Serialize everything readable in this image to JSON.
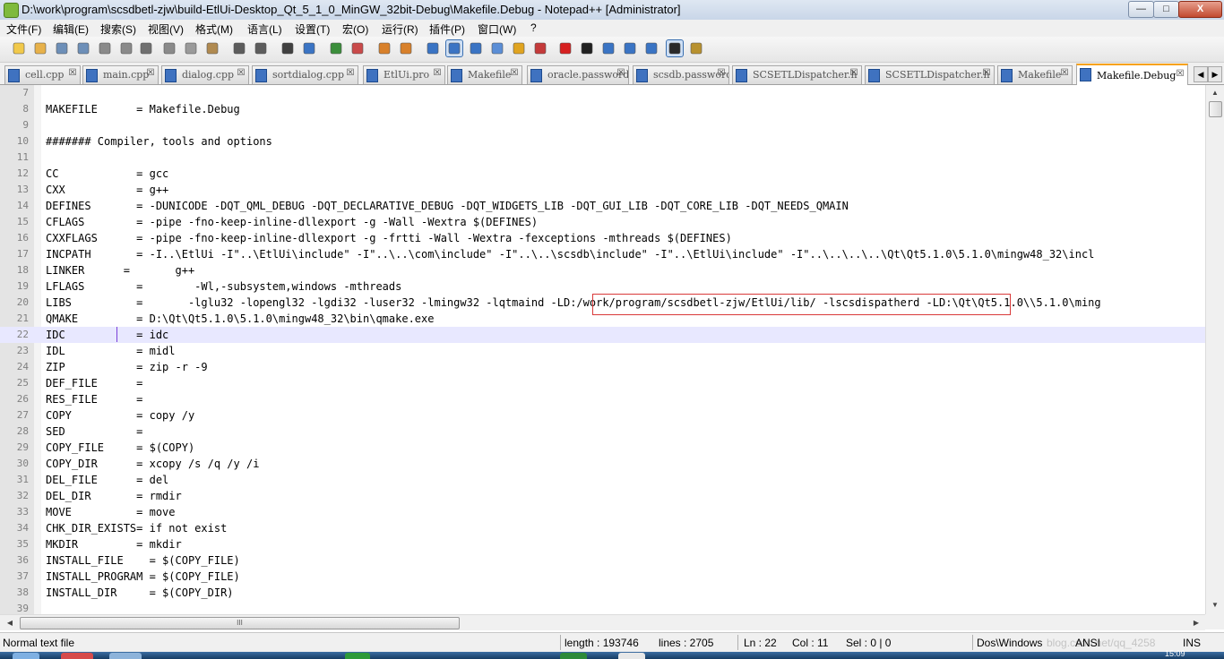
{
  "window": {
    "title": "D:\\work\\program\\scsdbetl-zjw\\build-EtlUi-Desktop_Qt_5_1_0_MinGW_32bit-Debug\\Makefile.Debug - Notepad++ [Administrator]",
    "minimize": "—",
    "maximize": "□",
    "close": "X"
  },
  "menu": [
    {
      "id": "file",
      "label": "文件(F)"
    },
    {
      "id": "edit",
      "label": "编辑(E)"
    },
    {
      "id": "search",
      "label": "搜索(S)"
    },
    {
      "id": "view",
      "label": "视图(V)"
    },
    {
      "id": "format",
      "label": "格式(M)"
    },
    {
      "id": "language",
      "label": "语言(L)"
    },
    {
      "id": "settings",
      "label": "设置(T)"
    },
    {
      "id": "macro",
      "label": "宏(O)"
    },
    {
      "id": "run",
      "label": "运行(R)"
    },
    {
      "id": "plugins",
      "label": "插件(P)"
    },
    {
      "id": "window",
      "label": "窗口(W)"
    },
    {
      "id": "help",
      "label": "?"
    }
  ],
  "toolbar": [
    {
      "name": "new-file-icon",
      "color": "#f1c94b"
    },
    {
      "name": "open-file-icon",
      "color": "#e7b14a"
    },
    {
      "name": "save-icon",
      "color": "#6d8fb8"
    },
    {
      "name": "save-all-icon",
      "color": "#6d8fb8"
    },
    {
      "name": "close-file-icon",
      "color": "#8a8a8a"
    },
    {
      "name": "close-all-icon",
      "color": "#8a8a8a"
    },
    {
      "name": "print-icon",
      "color": "#707070"
    },
    {
      "name": "cut-icon",
      "color": "#8a8a8a"
    },
    {
      "name": "copy-icon",
      "color": "#9a9a9a"
    },
    {
      "name": "paste-icon",
      "color": "#b08a50"
    },
    {
      "name": "undo-icon",
      "color": "#5c5c5c"
    },
    {
      "name": "redo-icon",
      "color": "#5c5c5c"
    },
    {
      "name": "find-icon",
      "color": "#404040"
    },
    {
      "name": "replace-icon",
      "color": "#3a74c4"
    },
    {
      "name": "zoom-in-icon",
      "color": "#3b8e3b"
    },
    {
      "name": "zoom-out-icon",
      "color": "#c94a4a"
    },
    {
      "name": "sync-vertical-icon",
      "color": "#d8802a"
    },
    {
      "name": "sync-horizontal-icon",
      "color": "#d8802a"
    },
    {
      "name": "word-wrap-icon",
      "color": "#3a74c4"
    },
    {
      "name": "show-all-chars-icon",
      "color": "#3a74c4"
    },
    {
      "name": "indent-guide-icon",
      "color": "#3a74c4"
    },
    {
      "name": "user-language-icon",
      "color": "#5b8ed6"
    },
    {
      "name": "doc-map-icon",
      "color": "#e0a420"
    },
    {
      "name": "function-list-icon",
      "color": "#c43a3a"
    },
    {
      "name": "record-macro-icon",
      "color": "#d62020"
    },
    {
      "name": "stop-record-icon",
      "color": "#202020"
    },
    {
      "name": "play-macro-icon",
      "color": "#3a74c4"
    },
    {
      "name": "run-macro-multiple-icon",
      "color": "#3a74c4"
    },
    {
      "name": "save-macro-icon",
      "color": "#3a74c4"
    },
    {
      "name": "spell-check-icon",
      "color": "#2a2a2a"
    },
    {
      "name": "settings-icon",
      "color": "#b8912e"
    }
  ],
  "tabs": [
    {
      "label": "cell.cpp",
      "active": false
    },
    {
      "label": "main.cpp",
      "active": false
    },
    {
      "label": "dialog.cpp",
      "active": false
    },
    {
      "label": "sortdialog.cpp",
      "active": false
    },
    {
      "label": "EtlUi.pro",
      "active": false
    },
    {
      "label": "Makefile",
      "active": false
    },
    {
      "label": "oracle.password",
      "active": false
    },
    {
      "label": "scsdb.password",
      "active": false
    },
    {
      "label": "SCSETLDispatcher.h",
      "active": false
    },
    {
      "label": "SCSETLDispatcher.h",
      "active": false
    },
    {
      "label": "Makefile",
      "active": false
    },
    {
      "label": "Makefile.Debug",
      "active": true
    }
  ],
  "tab_close_glyph": "☒",
  "tab_scroll": {
    "left": "◀",
    "right": "▶"
  },
  "editor": {
    "current_line": 22,
    "lines": [
      {
        "n": "7",
        "text": ""
      },
      {
        "n": "8",
        "text": "MAKEFILE      = Makefile.Debug"
      },
      {
        "n": "9",
        "text": ""
      },
      {
        "n": "10",
        "text": "####### Compiler, tools and options"
      },
      {
        "n": "11",
        "text": ""
      },
      {
        "n": "12",
        "text": "CC            = gcc"
      },
      {
        "n": "13",
        "text": "CXX           = g++"
      },
      {
        "n": "14",
        "text": "DEFINES       = -DUNICODE -DQT_QML_DEBUG -DQT_DECLARATIVE_DEBUG -DQT_WIDGETS_LIB -DQT_GUI_LIB -DQT_CORE_LIB -DQT_NEEDS_QMAIN"
      },
      {
        "n": "15",
        "text": "CFLAGS        = -pipe -fno-keep-inline-dllexport -g -Wall -Wextra $(DEFINES)"
      },
      {
        "n": "16",
        "text": "CXXFLAGS      = -pipe -fno-keep-inline-dllexport -g -frtti -Wall -Wextra -fexceptions -mthreads $(DEFINES)"
      },
      {
        "n": "17",
        "text": "INCPATH       = -I..\\EtlUi -I\"..\\EtlUi\\include\" -I\"..\\..\\com\\include\" -I\"..\\..\\scsdb\\include\" -I\"..\\EtlUi\\include\" -I\"..\\..\\..\\..\\Qt\\Qt5.1.0\\5.1.0\\mingw48_32\\incl"
      },
      {
        "n": "18",
        "text": "LINKER      =       g++"
      },
      {
        "n": "19",
        "text": "LFLAGS        =        -Wl,-subsystem,windows -mthreads"
      },
      {
        "n": "20",
        "text": "LIBS          =       -lglu32 -lopengl32 -lgdi32 -luser32 -lmingw32 -lqtmaind -LD:/work/program/scsdbetl-zjw/EtlUi/lib/ -lscsdispatherd -LD:\\Qt\\Qt5.1.0\\\\5.1.0\\ming"
      },
      {
        "n": "21",
        "text": "QMAKE         = D:\\Qt\\Qt5.1.0\\5.1.0\\mingw48_32\\bin\\qmake.exe"
      },
      {
        "n": "22",
        "text": "IDC           = idc"
      },
      {
        "n": "23",
        "text": "IDL           = midl"
      },
      {
        "n": "24",
        "text": "ZIP           = zip -r -9"
      },
      {
        "n": "25",
        "text": "DEF_FILE      ="
      },
      {
        "n": "26",
        "text": "RES_FILE      ="
      },
      {
        "n": "27",
        "text": "COPY          = copy /y"
      },
      {
        "n": "28",
        "text": "SED           ="
      },
      {
        "n": "29",
        "text": "COPY_FILE     = $(COPY)"
      },
      {
        "n": "30",
        "text": "COPY_DIR      = xcopy /s /q /y /i"
      },
      {
        "n": "31",
        "text": "DEL_FILE      = del"
      },
      {
        "n": "32",
        "text": "DEL_DIR       = rmdir"
      },
      {
        "n": "33",
        "text": "MOVE          = move"
      },
      {
        "n": "34",
        "text": "CHK_DIR_EXISTS= if not exist"
      },
      {
        "n": "35",
        "text": "MKDIR         = mkdir"
      },
      {
        "n": "36",
        "text": "INSTALL_FILE    = $(COPY_FILE)"
      },
      {
        "n": "37",
        "text": "INSTALL_PROGRAM = $(COPY_FILE)"
      },
      {
        "n": "38",
        "text": "INSTALL_DIR     = $(COPY_DIR)"
      },
      {
        "n": "39",
        "text": ""
      }
    ]
  },
  "scroll": {
    "up": "▲",
    "down": "▼",
    "left": "◀",
    "right": "▶",
    "thumb_grip": "III"
  },
  "status": {
    "file_type": "Normal text file",
    "length": "length : 193746",
    "lines": "lines : 2705",
    "ln": "Ln : 22",
    "col": "Col : 11",
    "sel": "Sel : 0 | 0",
    "eol": "Dos\\Windows",
    "encoding": "ANSI",
    "mode": "INS",
    "watermark": "blog.csdn.net/qq_4258"
  },
  "taskbar": {
    "time": "15:09"
  }
}
